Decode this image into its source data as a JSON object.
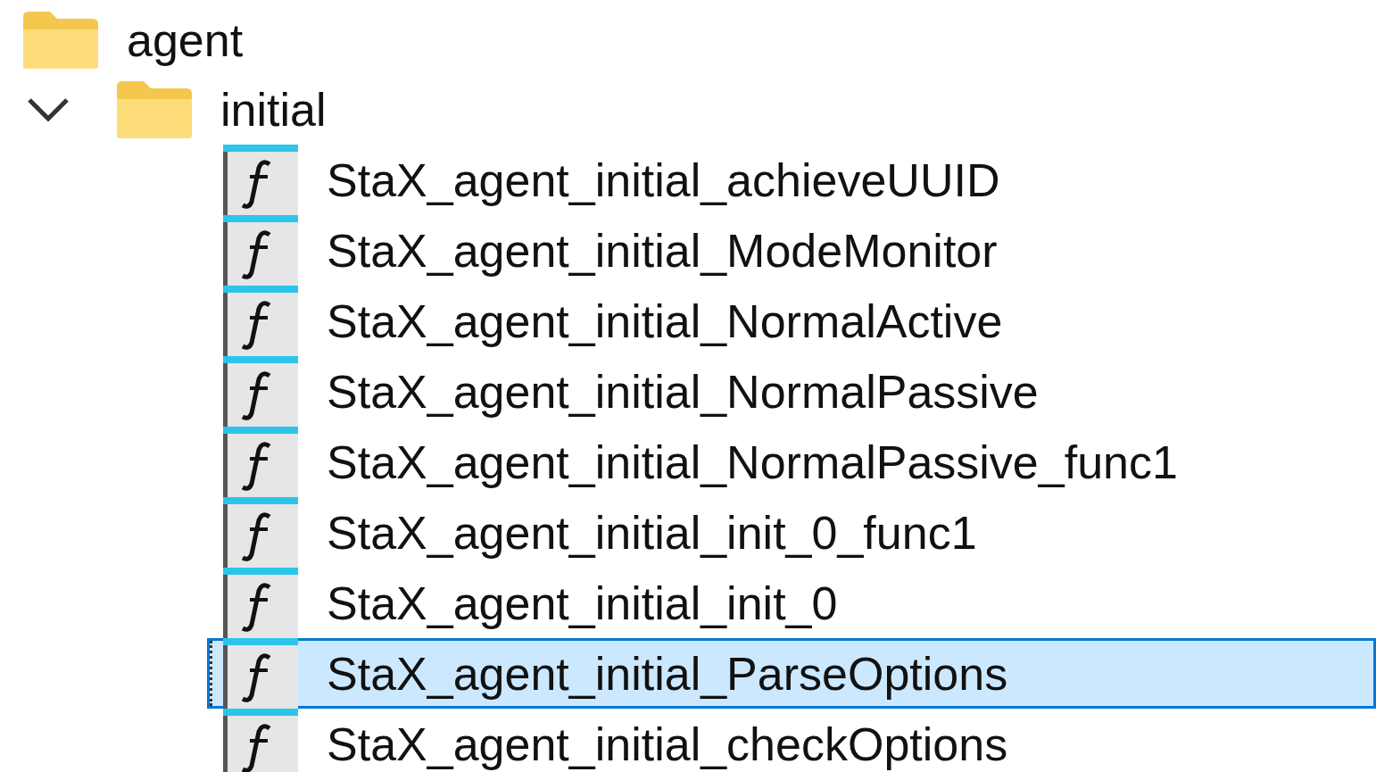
{
  "tree": [
    {
      "kind": "folder",
      "label": "agent",
      "children": [
        {
          "kind": "folder",
          "label": "initial",
          "expanded": true,
          "children": [
            {
              "kind": "function",
              "label": "StaX_agent_initial_achieveUUID",
              "selected": false
            },
            {
              "kind": "function",
              "label": "StaX_agent_initial_ModeMonitor",
              "selected": false
            },
            {
              "kind": "function",
              "label": "StaX_agent_initial_NormalActive",
              "selected": false
            },
            {
              "kind": "function",
              "label": "StaX_agent_initial_NormalPassive",
              "selected": false
            },
            {
              "kind": "function",
              "label": "StaX_agent_initial_NormalPassive_func1",
              "selected": false
            },
            {
              "kind": "function",
              "label": "StaX_agent_initial_init_0_func1",
              "selected": false
            },
            {
              "kind": "function",
              "label": "StaX_agent_initial_init_0",
              "selected": false
            },
            {
              "kind": "function",
              "label": "StaX_agent_initial_ParseOptions",
              "selected": true
            },
            {
              "kind": "function",
              "label": "StaX_agent_initial_checkOptions",
              "selected": false
            }
          ]
        }
      ]
    }
  ]
}
